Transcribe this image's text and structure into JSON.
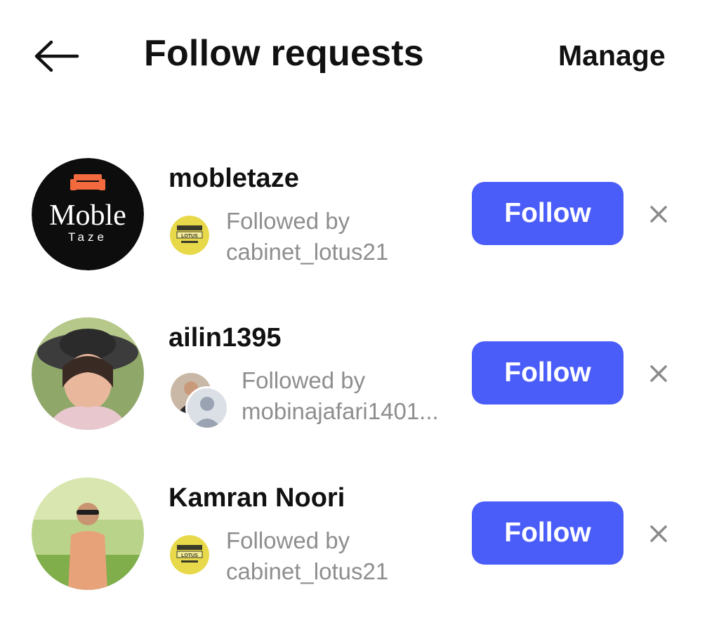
{
  "header": {
    "title": "Follow requests",
    "manage_label": "Manage",
    "back_icon": "arrow-left-icon"
  },
  "requests": [
    {
      "username": "mobletaze",
      "avatar_text_main": "Moble",
      "avatar_text_sub": "Taze",
      "followed_by_label": "Followed by",
      "followed_by_user": "cabinet_lotus21",
      "mutual_logo_text": "LOTUS",
      "follow_label": "Follow",
      "dismiss_icon": "close-icon"
    },
    {
      "username": "ailin1395",
      "followed_by_label": "Followed by",
      "followed_by_user": "mobinajafari1401...",
      "follow_label": "Follow",
      "dismiss_icon": "close-icon"
    },
    {
      "username": "Kamran Noori",
      "followed_by_label": "Followed by",
      "followed_by_user": "cabinet_lotus21",
      "mutual_logo_text": "LOTUS",
      "follow_label": "Follow",
      "dismiss_icon": "close-icon"
    }
  ],
  "colors": {
    "accent": "#4a5df9",
    "muted_text": "#8e8e8e",
    "text": "#111111",
    "background": "#ffffff"
  }
}
